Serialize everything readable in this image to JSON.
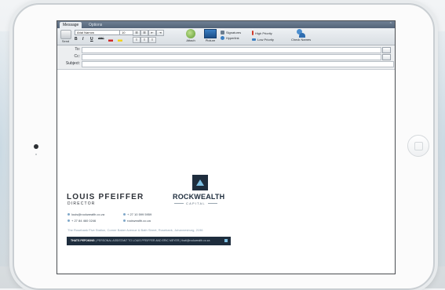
{
  "tabs": [
    {
      "label": "Message"
    },
    {
      "label": "Options"
    }
  ],
  "ribbon": {
    "send_label": "Send",
    "font_value": "Arial Narrow",
    "size_value": "10",
    "bold": "B",
    "italic": "I",
    "underline": "U",
    "strike": "ABC",
    "attach_label": "Attach",
    "picture_label": "Picture",
    "signatures_label": "Signatures",
    "hyperlink_label": "Hyperlink",
    "high_priority_label": "High Priority",
    "low_priority_label": "Low Priority",
    "check_names_label": "Check Names"
  },
  "address": {
    "to_label": "To:",
    "cc_label": "Cc:",
    "subject_label": "Subject:"
  },
  "signature": {
    "name": "LOUIS PFEIFFER",
    "title": "DIRECTOR",
    "brand": "ROCKWEALTH",
    "brand_sub": "CAPITAL",
    "email": "louis@rockwealth.co.za",
    "mobile": "+ 27 84 460 0246",
    "phone": "+ 27 10 599 5959",
    "web": "rockwealth.co.za",
    "address": "The Rosebank Five Station, Corner Baker Avenue & Bath Street, Rosebank, Johannesburg, 2196",
    "bar_prefix": "THATS PEFOKING",
    "bar_text": "| PERSONAL ASSISTANT TO LOUIS PFEIFFER AND ERIC MEYER | thati@rockwealth.co.za"
  },
  "colors": {
    "brand_navy": "#1e2d3d",
    "accent_blue": "#7ec0e3",
    "ribbon_top": "#6e7f93"
  }
}
